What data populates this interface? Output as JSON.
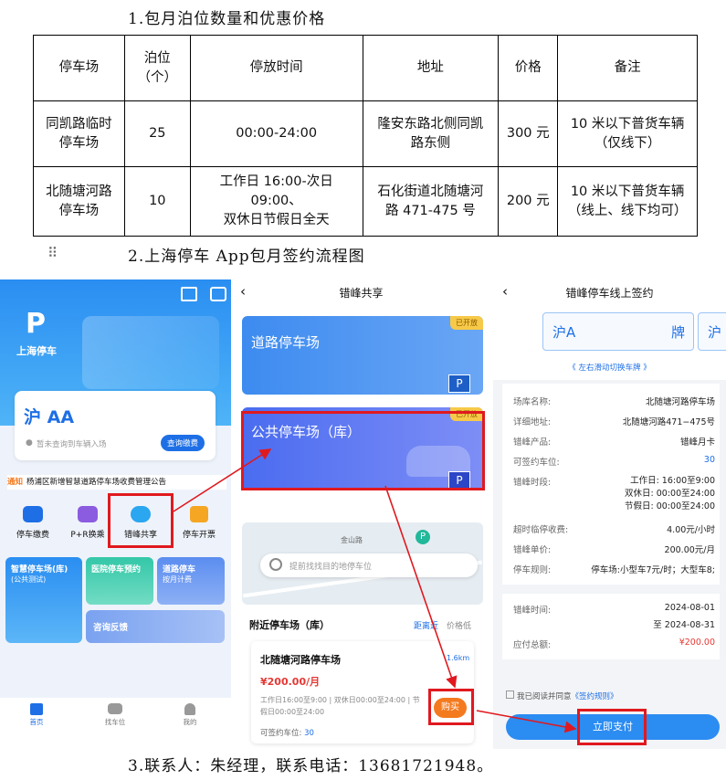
{
  "sections": {
    "s1": "1.包月泊位数量和优惠价格",
    "s2": "2.上海停车 App包月签约流程图",
    "s3": "3.联系人：朱经理，联系电话：13681721948。"
  },
  "table": {
    "headers": [
      "停车场",
      "泊位\n（个）",
      "停放时间",
      "地址",
      "价格",
      "备注"
    ],
    "rows": [
      [
        "同凯路临时\n停车场",
        "25",
        "00:00-24:00",
        "隆安东路北侧同凯\n路东侧",
        "300 元",
        "10 米以下普货车辆\n（仅线下）"
      ],
      [
        "北随塘河路\n停车场",
        "10",
        "工作日 16:00-次日\n09:00、\n双休日节假日全天",
        "石化街道北随塘河\n路 471-475 号",
        "200 元",
        "10 米以下普货车辆\n（线上、线下均可）"
      ]
    ]
  },
  "screen1": {
    "logo_text": "上海停车",
    "plate": "沪 AA",
    "plate_hint": "暂未查询到车辆入场",
    "query_btn": "查询缴费",
    "notice_tag": "通知",
    "notice": "杨浦区新增智慧道路停车场收费管理公告",
    "grid": [
      "停车缴费",
      "P+R换乘",
      "错峰共享",
      "停车开票"
    ],
    "tiles": {
      "t1_title": "智慧停车场(库)",
      "t1_sub": "(公共测试)",
      "t2_title": "医院停车预约",
      "t3_title": "道路停车",
      "t3_sub": "按月计费",
      "t4_title": "咨询反馈"
    },
    "tabs": [
      "首页",
      "找车位",
      "我的"
    ]
  },
  "screen2": {
    "title": "错峰共享",
    "badge1": "已开放",
    "badge2": "已开放",
    "card1": "道路停车场",
    "card2": "公共停车场（库）",
    "p_letter": "P",
    "search_placeholder": "提前找找目的地停车位",
    "map_label": "金山路",
    "nearby": "附近停车场（库）",
    "sort1": "距离近",
    "sort2": "价格低",
    "lot_name": "北随塘河路停车场",
    "distance": "1.6km",
    "price": "¥200.00/月",
    "hours": "工作日16:00至9:00 | 双休日00:00至24:00 | 节假日00:00至24:00",
    "avail_label": "可签约车位:",
    "avail_value": "30",
    "buy_btn": "购买"
  },
  "screen3": {
    "title": "错峰停车线上签约",
    "plate1": "沪A",
    "plate1_tail": "牌",
    "plate2": "沪",
    "swipe_hint": "《 左右滑动切换车牌 》",
    "fields": [
      {
        "label": "场库名称:",
        "value": "北随塘河路停车场"
      },
      {
        "label": "详细地址:",
        "value": "北随塘河路471−475号"
      },
      {
        "label": "错峰产品:",
        "value": "错峰月卡"
      },
      {
        "label": "可签约车位:",
        "value": "30"
      }
    ],
    "period_label": "错峰时段:",
    "period_lines": [
      "工作日: 16:00至9:00",
      "双休日: 00:00至24:00",
      "节假日: 00:00至24:00"
    ],
    "fields2": [
      {
        "label": "超时临停收费:",
        "value": "4.00元/小时"
      },
      {
        "label": "错峰单价:",
        "value": "200.00元/月"
      }
    ],
    "rule_label": "停车规则:",
    "rule_value": "停车场:小型车7元/时；大型车8;",
    "time_label": "错峰时间:",
    "time_from": "2024-08-01",
    "time_to": "至 2024-08-31",
    "total_label": "应付总额:",
    "total_value": "¥200.00",
    "agree_prefix": "我已阅读并同意",
    "agree_link": "《签约规则》",
    "pay_btn": "立即支付"
  },
  "colors": {
    "accent": "#1e6fe6",
    "red": "#e0191f",
    "orange": "#f47a1f",
    "price": "#e53935"
  }
}
